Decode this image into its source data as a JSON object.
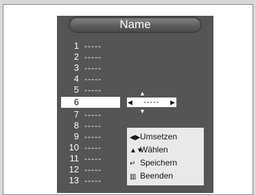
{
  "menu": {
    "title": "Name",
    "rows": [
      {
        "num": "1",
        "value": "-----"
      },
      {
        "num": "2",
        "value": "-----"
      },
      {
        "num": "3",
        "value": "-----"
      },
      {
        "num": "4",
        "value": "-----"
      },
      {
        "num": "5",
        "value": "-----"
      },
      {
        "num": "6",
        "value": "-----"
      },
      {
        "num": "7",
        "value": "-----"
      },
      {
        "num": "8",
        "value": "-----"
      },
      {
        "num": "9",
        "value": "-----"
      },
      {
        "num": "10",
        "value": "-----"
      },
      {
        "num": "11",
        "value": "-----"
      },
      {
        "num": "12",
        "value": "-----"
      },
      {
        "num": "13",
        "value": "-----"
      }
    ],
    "selected_row": "6"
  },
  "editor": {
    "value": "-----"
  },
  "help": {
    "move": {
      "icon": "left-right-arrows-icon",
      "label": "Umsetzen"
    },
    "select": {
      "icon": "up-down-arrows-icon",
      "label": "Wählen"
    },
    "save": {
      "icon": "enter-icon",
      "label": "Speichern"
    },
    "exit": {
      "icon": "menu-icon",
      "label": "Beenden"
    }
  },
  "colors": {
    "osd_background": "#555555",
    "highlight": "#ffffff",
    "help_background": "#e9e9e9"
  }
}
